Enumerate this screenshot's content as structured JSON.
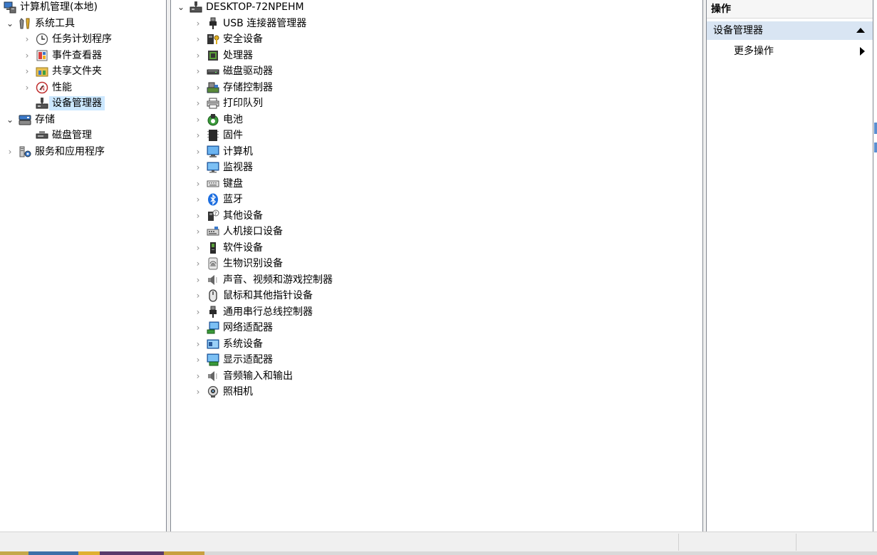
{
  "nav_tree": {
    "root": {
      "label": "计算机管理(本地)",
      "icon": "computer-management-icon"
    },
    "groups": [
      {
        "label": "系统工具",
        "icon": "system-tools-icon",
        "expanded": true,
        "children": [
          {
            "label": "任务计划程序",
            "icon": "task-scheduler-icon",
            "has_children": true
          },
          {
            "label": "事件查看器",
            "icon": "event-viewer-icon",
            "has_children": true
          },
          {
            "label": "共享文件夹",
            "icon": "shared-folders-icon",
            "has_children": true
          },
          {
            "label": "性能",
            "icon": "performance-icon",
            "has_children": true
          },
          {
            "label": "设备管理器",
            "icon": "device-manager-icon",
            "has_children": false,
            "selected": true
          }
        ]
      },
      {
        "label": "存储",
        "icon": "storage-icon",
        "expanded": true,
        "children": [
          {
            "label": "磁盘管理",
            "icon": "disk-management-icon",
            "has_children": false
          }
        ]
      },
      {
        "label": "服务和应用程序",
        "icon": "services-apps-icon",
        "expanded": false,
        "children": []
      }
    ]
  },
  "device_tree": {
    "computer_name": "DESKTOP-72NPEHM",
    "categories": [
      {
        "label": "USB 连接器管理器",
        "icon": "usb-connector-icon"
      },
      {
        "label": "安全设备",
        "icon": "security-device-icon"
      },
      {
        "label": "处理器",
        "icon": "processor-icon"
      },
      {
        "label": "磁盘驱动器",
        "icon": "disk-drive-icon"
      },
      {
        "label": "存储控制器",
        "icon": "storage-controller-icon"
      },
      {
        "label": "打印队列",
        "icon": "printer-icon"
      },
      {
        "label": "电池",
        "icon": "battery-icon"
      },
      {
        "label": "固件",
        "icon": "firmware-icon"
      },
      {
        "label": "计算机",
        "icon": "computer-icon"
      },
      {
        "label": "监视器",
        "icon": "monitor-icon"
      },
      {
        "label": "键盘",
        "icon": "keyboard-icon"
      },
      {
        "label": "蓝牙",
        "icon": "bluetooth-icon"
      },
      {
        "label": "其他设备",
        "icon": "other-devices-icon"
      },
      {
        "label": "人机接口设备",
        "icon": "hid-icon"
      },
      {
        "label": "软件设备",
        "icon": "software-device-icon"
      },
      {
        "label": "生物识别设备",
        "icon": "biometric-icon"
      },
      {
        "label": "声音、视频和游戏控制器",
        "icon": "sound-icon"
      },
      {
        "label": "鼠标和其他指针设备",
        "icon": "mouse-icon"
      },
      {
        "label": "通用串行总线控制器",
        "icon": "usb-controller-icon"
      },
      {
        "label": "网络适配器",
        "icon": "network-adapter-icon"
      },
      {
        "label": "系统设备",
        "icon": "system-devices-icon"
      },
      {
        "label": "显示适配器",
        "icon": "display-adapter-icon"
      },
      {
        "label": "音频输入和输出",
        "icon": "audio-io-icon"
      },
      {
        "label": "照相机",
        "icon": "camera-icon"
      }
    ]
  },
  "actions": {
    "header": "操作",
    "section_title": "设备管理器",
    "more_label": "更多操作"
  },
  "colors": {
    "selection": "#cce8ff",
    "section_bg": "#d9e5f3",
    "pane_border": "#828790"
  }
}
